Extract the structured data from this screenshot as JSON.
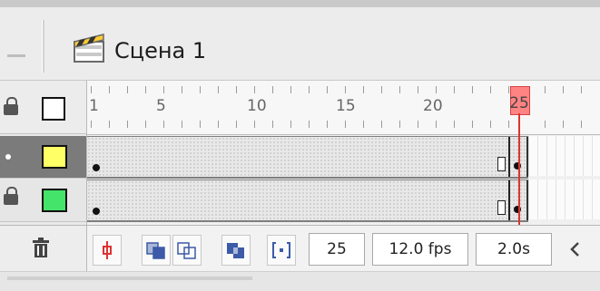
{
  "scene": {
    "title": "Сцена 1",
    "icon": "clapperboard-icon"
  },
  "ruler": {
    "labels": [
      "1",
      "5",
      "10",
      "15",
      "20",
      "25"
    ]
  },
  "playhead": {
    "frame": "25"
  },
  "layers": [
    {
      "swatch_color": "#ffff66",
      "selected": true
    },
    {
      "swatch_color": "#44e46a",
      "selected": false
    }
  ],
  "footer": {
    "current_frame": "25",
    "fps": "12.0 fps",
    "time": "2.0s",
    "scroll_icon": "chevron-left-icon"
  },
  "colors": {
    "playhead": "#ff6e6e",
    "selected_row": "#7b7b7b"
  }
}
